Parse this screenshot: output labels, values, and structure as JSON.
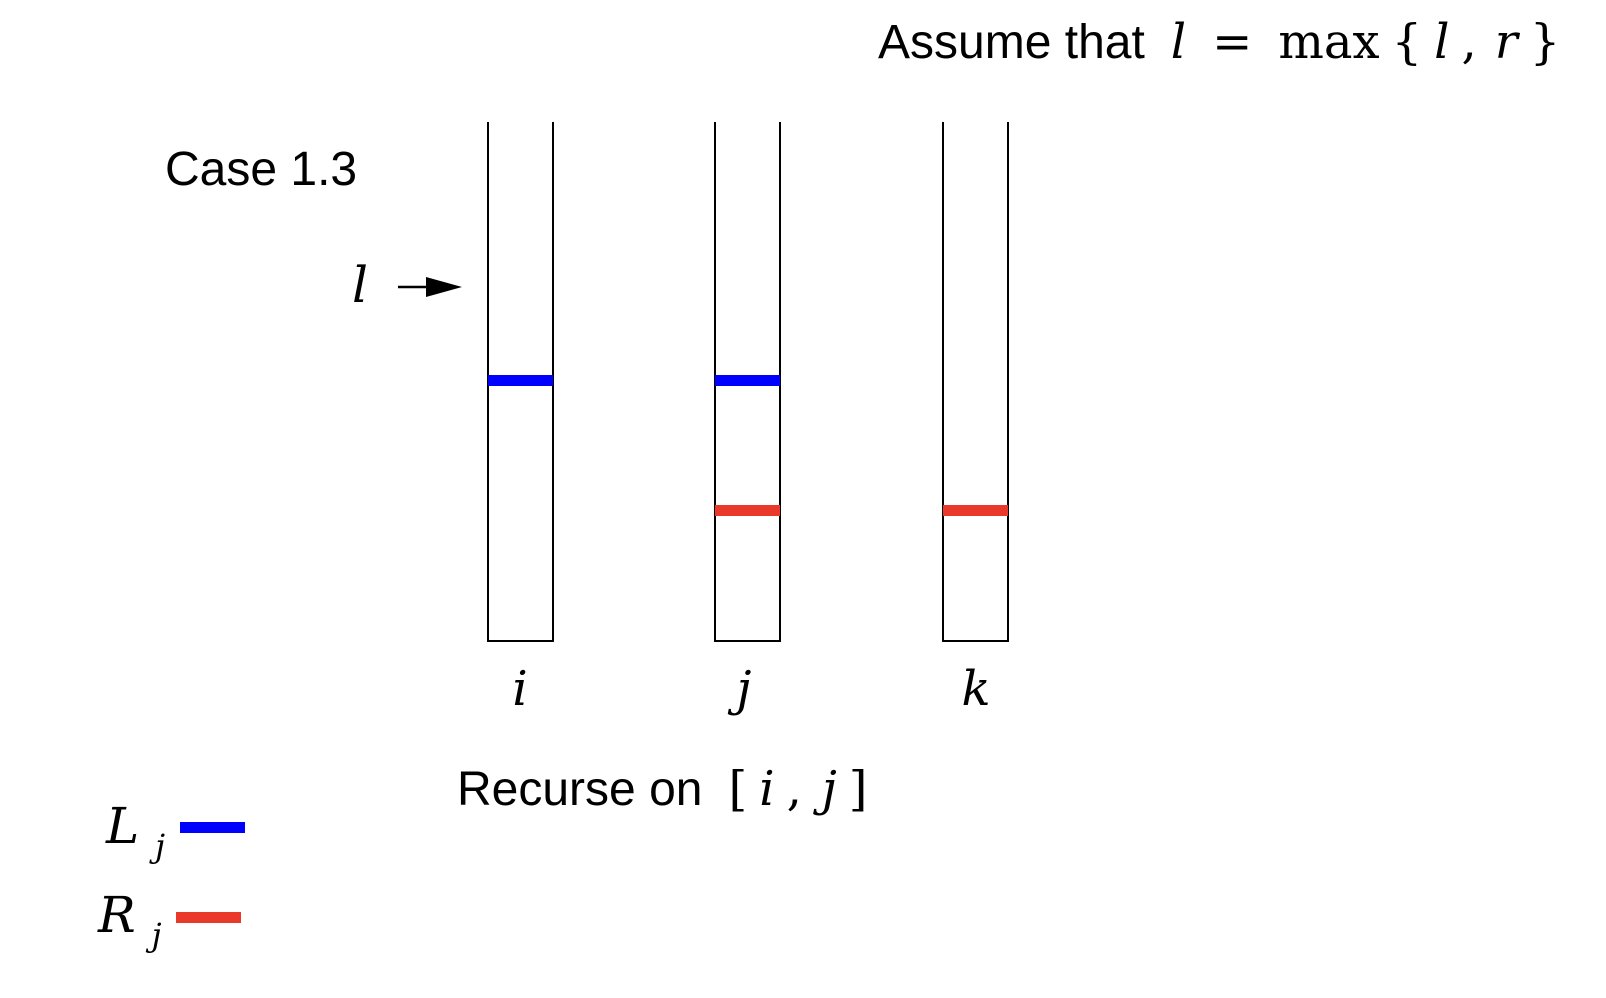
{
  "assumption": {
    "prefix": "Assume that",
    "var": "l",
    "equals": "=",
    "func": "max",
    "open": "{",
    "a": "l",
    "comma": ",",
    "b": "r",
    "close": "}"
  },
  "case_label": "Case 1.3",
  "pointer": {
    "label": "l"
  },
  "columns": [
    {
      "id": "i",
      "label": "i"
    },
    {
      "id": "j",
      "label": "j"
    },
    {
      "id": "k",
      "label": "k"
    }
  ],
  "recurse": {
    "prefix": "Recurse on",
    "open": "[",
    "a": "i",
    "comma": ",",
    "b": "j",
    "close": "]"
  },
  "legend": [
    {
      "main": "L",
      "sub": "j",
      "color": "#0000ff"
    },
    {
      "main": "R",
      "sub": "j",
      "color": "#e8392b"
    }
  ],
  "colors": {
    "L": "#0000ff",
    "R": "#e8392b"
  }
}
